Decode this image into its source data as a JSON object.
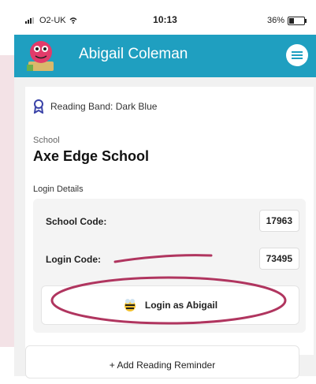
{
  "status_bar": {
    "carrier": "O2-UK",
    "time": "10:13",
    "battery": "36%"
  },
  "app_bar": {
    "title": "Abigail Coleman"
  },
  "profile": {
    "reading_band_label": "Reading Band: Dark Blue",
    "school_label": "School",
    "school_name": "Axe Edge School",
    "login_details_label": "Login Details",
    "school_code_label": "School Code:",
    "school_code_value": "17963",
    "login_code_label": "Login Code:",
    "login_code_value": "73495",
    "login_button_label": "Login as Abigail",
    "reminder_button_label": "+ Add Reading Reminder"
  },
  "colors": {
    "app_bar": "#1f9fc0",
    "annotation": "#b0355f",
    "band_icon": "#3a43a8"
  },
  "icons": {
    "band": "ribbon-icon",
    "menu": "hamburger-icon",
    "login": "bee-icon"
  }
}
